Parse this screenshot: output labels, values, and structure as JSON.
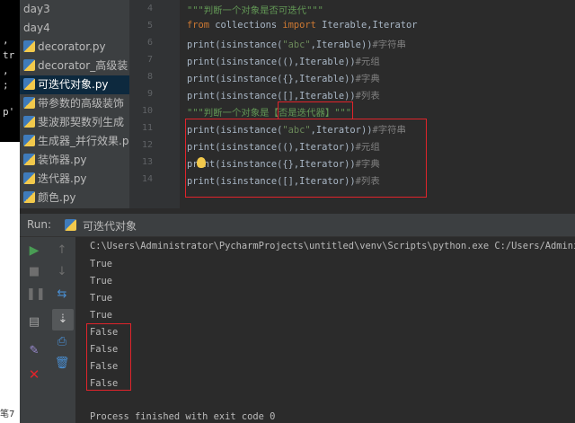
{
  "project_tree": {
    "items": [
      {
        "label": "day3",
        "type": "folder"
      },
      {
        "label": "day4",
        "type": "folder"
      },
      {
        "label": "decorator.py",
        "type": "py"
      },
      {
        "label": "decorator_高级装",
        "type": "py"
      },
      {
        "label": "可迭代对象.py",
        "type": "py",
        "selected": true
      },
      {
        "label": "带参数的高级装饰",
        "type": "py"
      },
      {
        "label": "斐波那契数列生成",
        "type": "py"
      },
      {
        "label": "生成器_并行效果.p",
        "type": "py"
      },
      {
        "label": "装饰器.py",
        "type": "py"
      },
      {
        "label": "迭代器.py",
        "type": "py"
      },
      {
        "label": "颜色.py",
        "type": "py"
      }
    ]
  },
  "editor": {
    "line_numbers": [
      "4",
      "5",
      "6",
      "7",
      "8",
      "9",
      "10",
      "11",
      "12",
      "13",
      "14"
    ],
    "lines": [
      {
        "parts": [
          {
            "t": "\"\"\"判断一个对象是否可迭代\"\"\"",
            "c": "doc"
          }
        ]
      },
      {
        "parts": [
          {
            "t": "from",
            "c": "kw"
          },
          {
            "t": " collections ",
            "c": "id"
          },
          {
            "t": "import",
            "c": "kw"
          },
          {
            "t": " Iterable,Iterator",
            "c": "id"
          }
        ]
      },
      {
        "parts": [
          {
            "t": "print(isinstance(",
            "c": "id"
          },
          {
            "t": "\"abc\"",
            "c": "str"
          },
          {
            "t": ",Iterable))",
            "c": "id"
          },
          {
            "t": "#字符串",
            "c": "cmt"
          }
        ]
      },
      {
        "parts": [
          {
            "t": "print(isinstance((),Iterable))",
            "c": "id"
          },
          {
            "t": "#元组",
            "c": "cmt"
          }
        ]
      },
      {
        "parts": [
          {
            "t": "print(isinstance({},Iterable))",
            "c": "id"
          },
          {
            "t": "#字典",
            "c": "cmt"
          }
        ]
      },
      {
        "parts": [
          {
            "t": "print(isinstance([],Iterable))",
            "c": "id"
          },
          {
            "t": "#列表",
            "c": "cmt"
          }
        ]
      },
      {
        "parts": [
          {
            "t": "\"\"\"判断一个对象是【否是迭代器】\"\"\"",
            "c": "doc"
          }
        ]
      },
      {
        "parts": [
          {
            "t": "print(isinstance(",
            "c": "id"
          },
          {
            "t": "\"abc\"",
            "c": "str"
          },
          {
            "t": ",Iterator))",
            "c": "id"
          },
          {
            "t": "#字符串",
            "c": "cmt"
          }
        ]
      },
      {
        "parts": [
          {
            "t": "print(isinstance((),Iterator))",
            "c": "id"
          },
          {
            "t": "#元组",
            "c": "cmt"
          }
        ]
      },
      {
        "parts": [
          {
            "t": "print(isinstance({},Iterator))",
            "c": "id"
          },
          {
            "t": "#字典",
            "c": "cmt"
          }
        ]
      },
      {
        "parts": [
          {
            "t": "print(isinstance([],Iterator))",
            "c": "id"
          },
          {
            "t": "#列表",
            "c": "cmt"
          }
        ]
      }
    ]
  },
  "run_panel": {
    "label": "Run:",
    "tab_title": "可迭代对象",
    "command": "C:\\Users\\Administrator\\PycharmProjects\\untitled\\venv\\Scripts\\python.exe C:/Users/Administrator",
    "output": [
      "True",
      "True",
      "True",
      "True",
      "False",
      "False",
      "False",
      "False"
    ],
    "exit_message": "Process finished with exit code 0"
  },
  "left_strip": {
    "term_chars": [
      ",",
      "tr",
      ",",
      ";",
      "p'"
    ],
    "bottom_text": "笔7"
  },
  "colors": {
    "highlight_box": "#e0242b",
    "selected_row": "#0d293e"
  }
}
